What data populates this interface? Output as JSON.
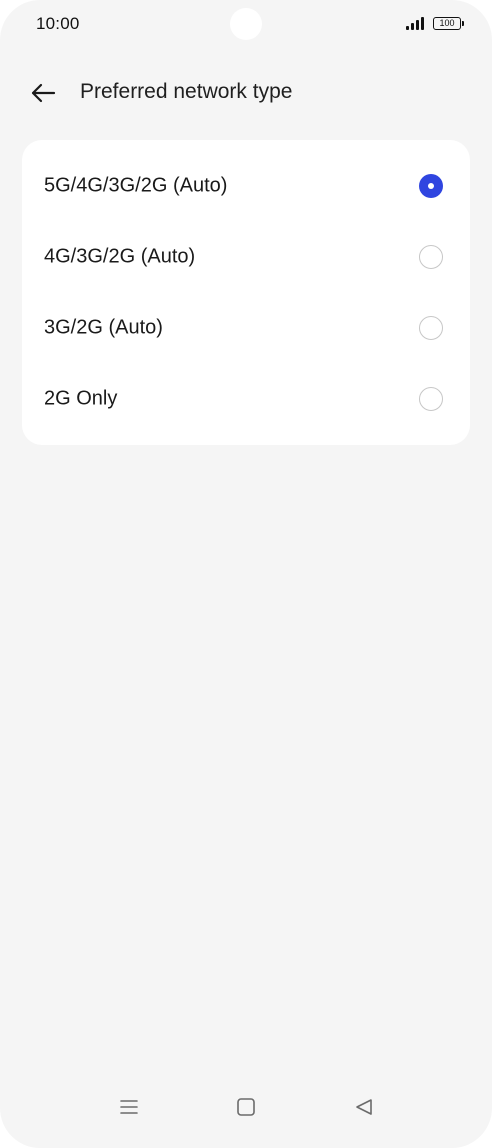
{
  "status_bar": {
    "time": "10:00",
    "battery": "100",
    "signal_icon": "signal-bars-icon",
    "battery_icon": "battery-icon"
  },
  "header": {
    "title": "Preferred network type",
    "back_icon": "arrow-left-icon"
  },
  "options": [
    {
      "label": "5G/4G/3G/2G (Auto)",
      "selected": true
    },
    {
      "label": "4G/3G/2G (Auto)",
      "selected": false
    },
    {
      "label": "3G/2G (Auto)",
      "selected": false
    },
    {
      "label": "2G Only",
      "selected": false
    }
  ],
  "navigation_bar": {
    "menu_icon": "menu-icon",
    "home_icon": "home-square-icon",
    "back_icon": "back-triangle-icon"
  },
  "colors": {
    "accent": "#2f45e0",
    "background": "#f5f5f5",
    "card": "#ffffff"
  }
}
